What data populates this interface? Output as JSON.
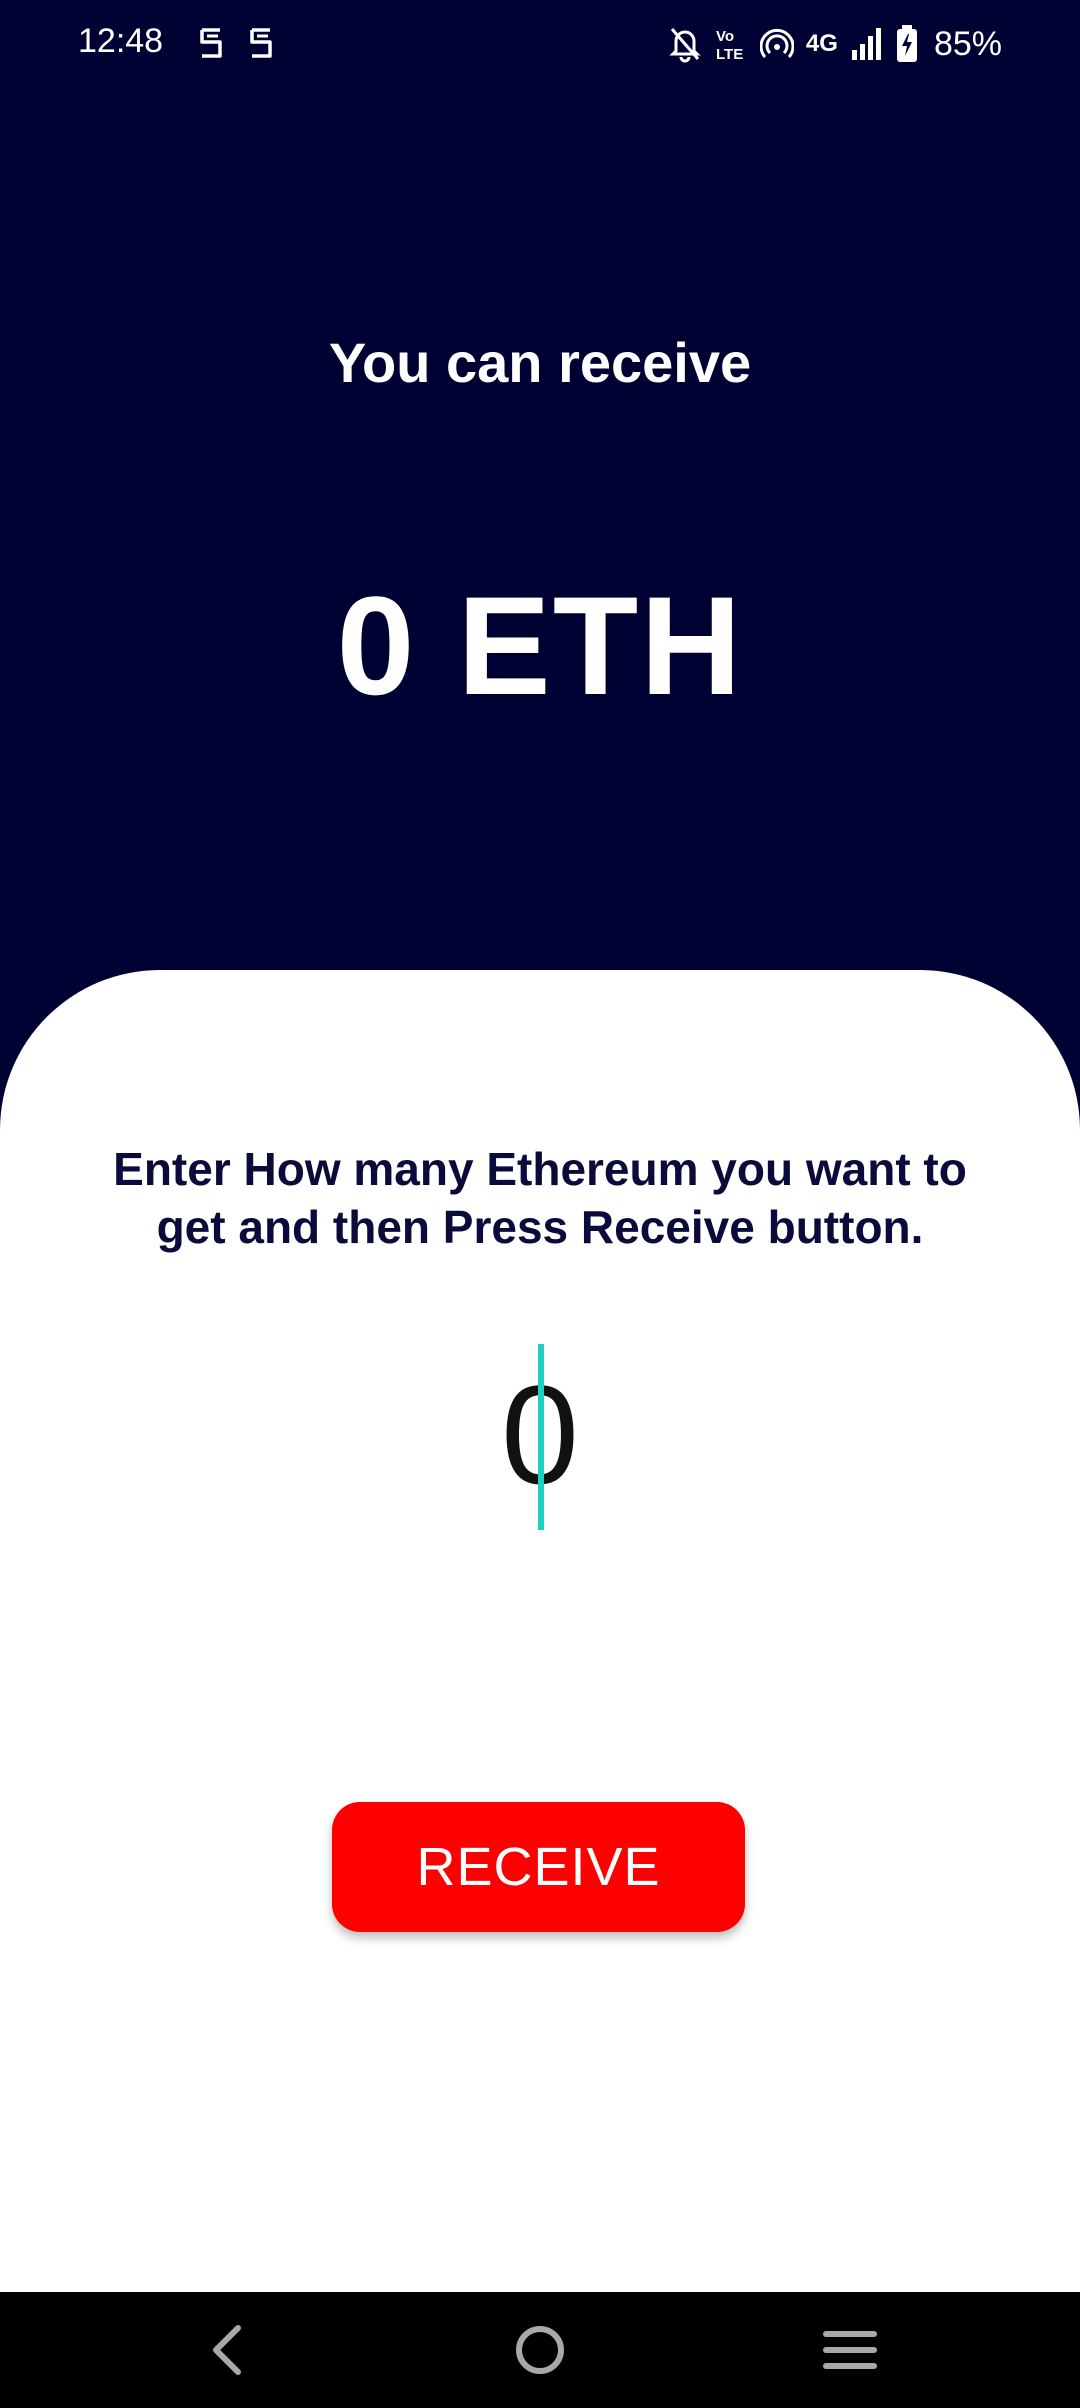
{
  "status_bar": {
    "time": "12:48",
    "battery": "85%",
    "network": "4G",
    "app_icons": [
      "s-app-icon",
      "s-app-icon"
    ],
    "right_icons": [
      "silent-bell-icon",
      "volte-icon",
      "hotspot-icon",
      "signal-icon",
      "battery-charging-icon"
    ],
    "volte_label": "Vo LTE"
  },
  "header": {
    "title": "You can receive",
    "amount": "0 ETH"
  },
  "form": {
    "instruction": "Enter How many Ethereum you want to get and then Press Receive button.",
    "amount_value": "0",
    "receive_label": "RECEIVE"
  },
  "nav": {
    "icons": [
      "back-icon",
      "home-icon",
      "menu-icon"
    ]
  },
  "colors": {
    "background": "#000133",
    "accent": "#ff0000",
    "caret": "#1fcfc0",
    "text_dark": "#0b0b3b"
  }
}
